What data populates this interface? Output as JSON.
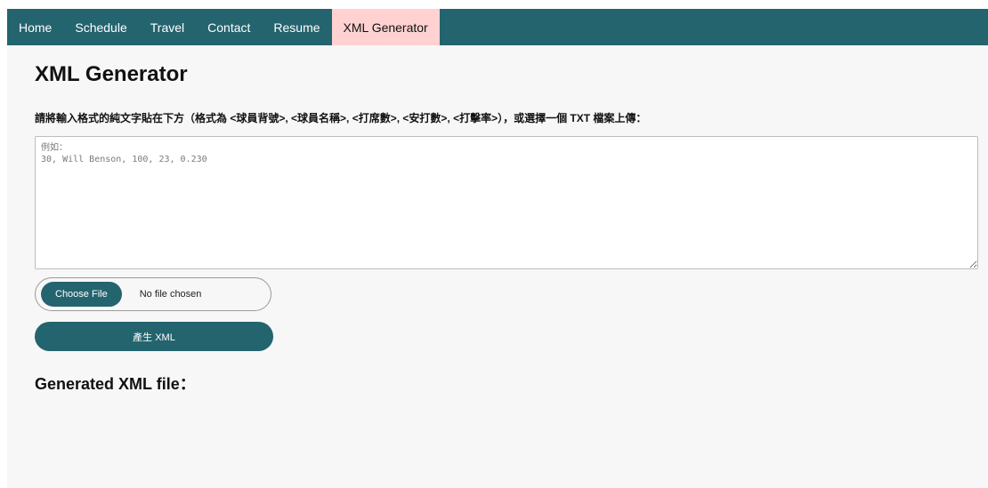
{
  "nav": {
    "items": [
      {
        "label": "Home"
      },
      {
        "label": "Schedule"
      },
      {
        "label": "Travel"
      },
      {
        "label": "Contact"
      },
      {
        "label": "Resume"
      },
      {
        "label": "XML Generator"
      }
    ],
    "active": "XML Generator"
  },
  "main": {
    "title": "XML Generator",
    "instructions": "請將輸入格式的純文字貼在下方（格式為 <球員背號>, <球員名稱>, <打席數>, <安打數>, <打擊率>），或選擇一個 TXT 檔案上傳：",
    "textarea": {
      "placeholder": "例如：\n30, Will Benson, 100, 23, 0.230",
      "value": ""
    },
    "file_input": {
      "button_label": "Choose File",
      "status": "No file chosen"
    },
    "generate_button": "產生 XML",
    "output_heading": "Generated XML file："
  },
  "colors": {
    "nav_background": "#24646f",
    "nav_active_background": "#ffd1d1",
    "button_background": "#24646f",
    "page_background": "#f7f7f7"
  }
}
